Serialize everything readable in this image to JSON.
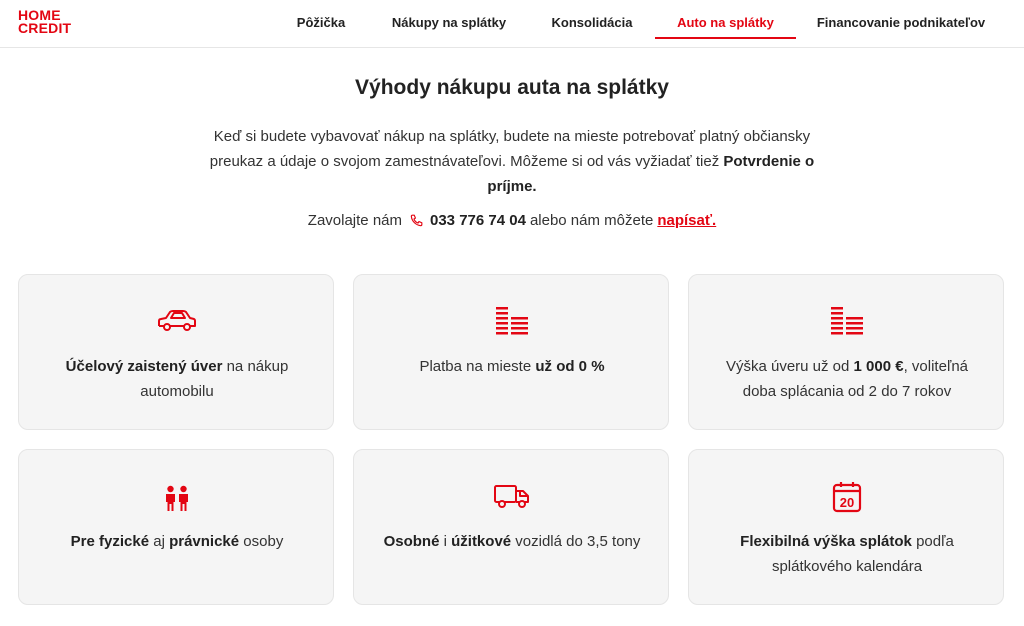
{
  "brand": {
    "line1": "HOME",
    "line2": "CREDIT",
    "color": "#e30613"
  },
  "nav": {
    "items": [
      {
        "label": "Pôžička"
      },
      {
        "label": "Nákupy na splátky"
      },
      {
        "label": "Konsolidácia"
      },
      {
        "label": "Auto na splátky",
        "active": true
      },
      {
        "label": "Financovanie podnikateľov"
      }
    ]
  },
  "main": {
    "title": "Výhody nákupu auta na splátky",
    "intro_text": "Keď si budete vybavovať nákup na splátky, budete na mieste potrebovať platný občiansky preukaz a údaje o svojom zamestnávateľovi. Môžeme si od vás vyžiadať tiež ",
    "intro_bold": "Potvrdenie o príjme",
    "intro_end": ".",
    "contact_prefix": "Zavolajte nám",
    "phone": "033 776 74 04",
    "contact_middle": "alebo nám môžete",
    "contact_link": "napísať."
  },
  "cards": [
    {
      "icon": "car-icon",
      "bold": "Účelový zaistený úver",
      "rest": " na nákup automobilu"
    },
    {
      "icon": "bars-icon",
      "pre": "Platba na mieste ",
      "bold": "už od 0 %"
    },
    {
      "icon": "bars-icon",
      "pre": "Výška úveru už od ",
      "bold": "1 000 €",
      "rest": ", voliteľná doba splácania od 2 do 7 rokov"
    },
    {
      "icon": "people-icon",
      "bold": "Pre fyzické",
      "mid": " aj ",
      "bold2": "právnické",
      "rest": " osoby"
    },
    {
      "icon": "truck-icon",
      "bold": "Osobné",
      "mid": " i ",
      "bold2": "úžitkové",
      "rest": " vozidlá do 3,5 tony"
    },
    {
      "icon": "calendar-icon",
      "icon_text": "20",
      "bold": "Flexibilná výška splátok",
      "rest": " podľa splátkového kalendára"
    }
  ]
}
